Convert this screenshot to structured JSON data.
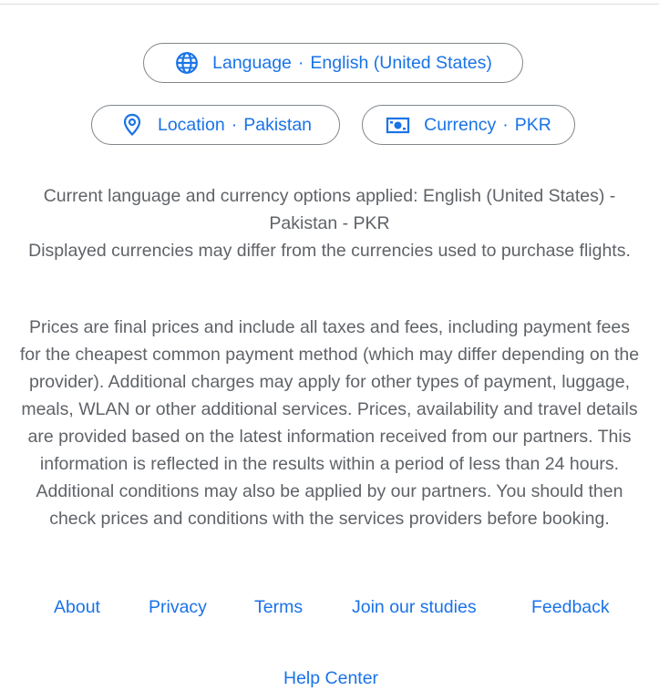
{
  "settings": {
    "language": {
      "label": "Language",
      "separator": "·",
      "value": "English (United States)",
      "icon": "globe-icon"
    },
    "location": {
      "label": "Location",
      "separator": "·",
      "value": "Pakistan",
      "icon": "location-pin-icon"
    },
    "currency": {
      "label": "Currency",
      "separator": "·",
      "value": "PKR",
      "icon": "banknote-icon"
    }
  },
  "info": {
    "applied_line1": "Current language and currency options applied: English (United States) -",
    "applied_line2": "Pakistan - PKR",
    "displayed_note": "Displayed currencies may differ from the currencies used to purchase flights.",
    "prices_disclaimer": "Prices are final prices and include all taxes and fees, including payment fees for the cheapest common payment method (which may differ depending on the provider). Additional charges may apply for other types of payment, luggage, meals, WLAN or other additional services. Prices, availability and travel details are provided based on the latest information received from our partners. This information is reflected in the results within a period of less than 24 hours. Additional conditions may also be applied by our partners. You should then check prices and conditions with the services providers before booking."
  },
  "footer": {
    "about": "About",
    "privacy": "Privacy",
    "terms": "Terms",
    "join_studies": "Join our studies",
    "feedback": "Feedback",
    "help_center": "Help Center"
  },
  "colors": {
    "link": "#1a73e8",
    "text": "#5f6368",
    "border": "#80868b"
  }
}
